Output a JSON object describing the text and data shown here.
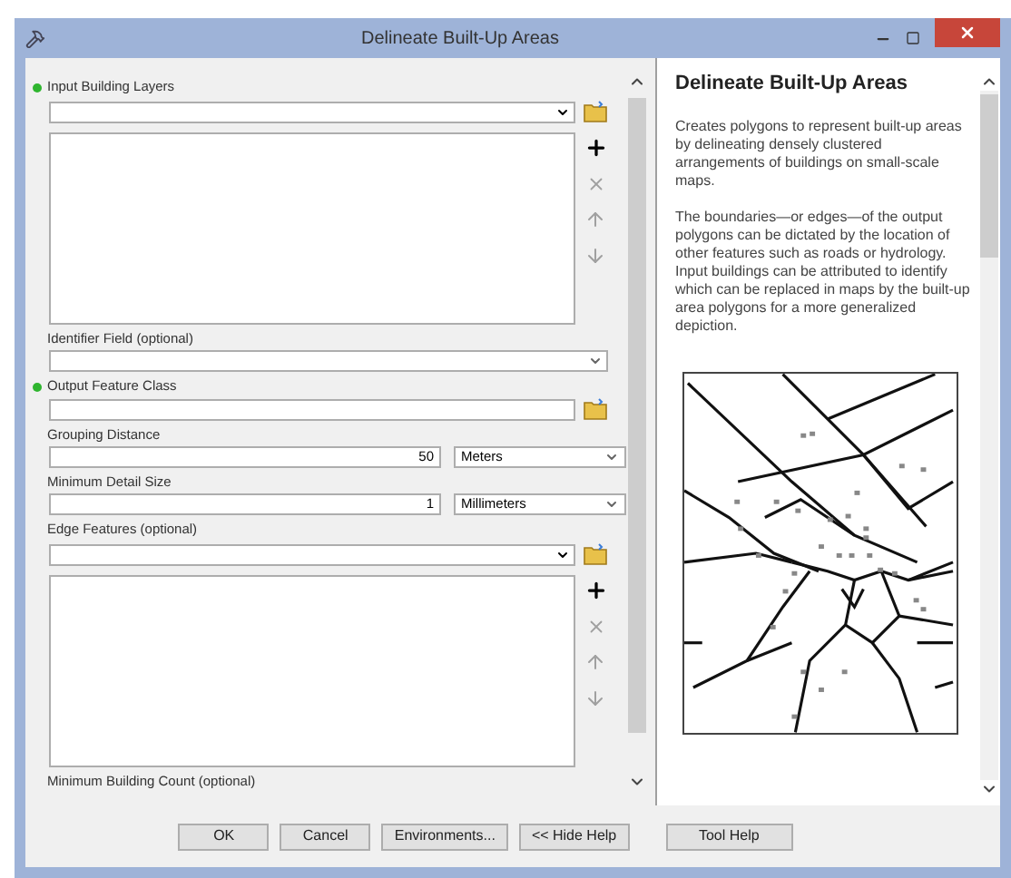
{
  "window": {
    "title": "Delineate Built-Up Areas"
  },
  "parameters": [
    {
      "kind": "multi_value",
      "label": "Input Building Layers",
      "required": true,
      "tools": [
        {
          "kind": "add",
          "disabled": false
        },
        {
          "kind": "remove",
          "disabled": true
        },
        {
          "kind": "up",
          "disabled": true
        },
        {
          "kind": "down",
          "disabled": true
        }
      ]
    },
    {
      "kind": "combo",
      "label": "Identifier Field (optional)",
      "required": false
    },
    {
      "kind": "dataset",
      "label": "Output Feature Class",
      "required": true
    },
    {
      "kind": "number_unit",
      "label": "Grouping Distance",
      "required": false,
      "value": "50",
      "unit": "Meters"
    },
    {
      "kind": "number_unit",
      "label": "Minimum Detail Size",
      "required": false,
      "value": "1",
      "unit": "Millimeters"
    },
    {
      "kind": "multi_value",
      "label": "Edge Features (optional)",
      "required": false,
      "tools": [
        {
          "kind": "add",
          "disabled": false
        },
        {
          "kind": "remove",
          "disabled": true
        },
        {
          "kind": "up",
          "disabled": true
        },
        {
          "kind": "down",
          "disabled": true
        }
      ]
    },
    {
      "kind": "label_only",
      "label": "Minimum Building Count (optional)",
      "required": false
    }
  ],
  "help": {
    "title": "Delineate Built-Up Areas",
    "paragraphs": [
      "Creates polygons to represent built-up areas by delineating densely clustered arrangements of buildings on small-scale maps.",
      "The boundaries—or edges—of the output polygons can be dictated by the location of other features such as roads or hydrology. Input buildings can be attributed to identify which can be replaced in maps by the built-up area polygons for a more generalized depiction."
    ]
  },
  "buttons": [
    "OK",
    "Cancel",
    "Environments...",
    "<< Hide Help",
    "Tool Help"
  ]
}
